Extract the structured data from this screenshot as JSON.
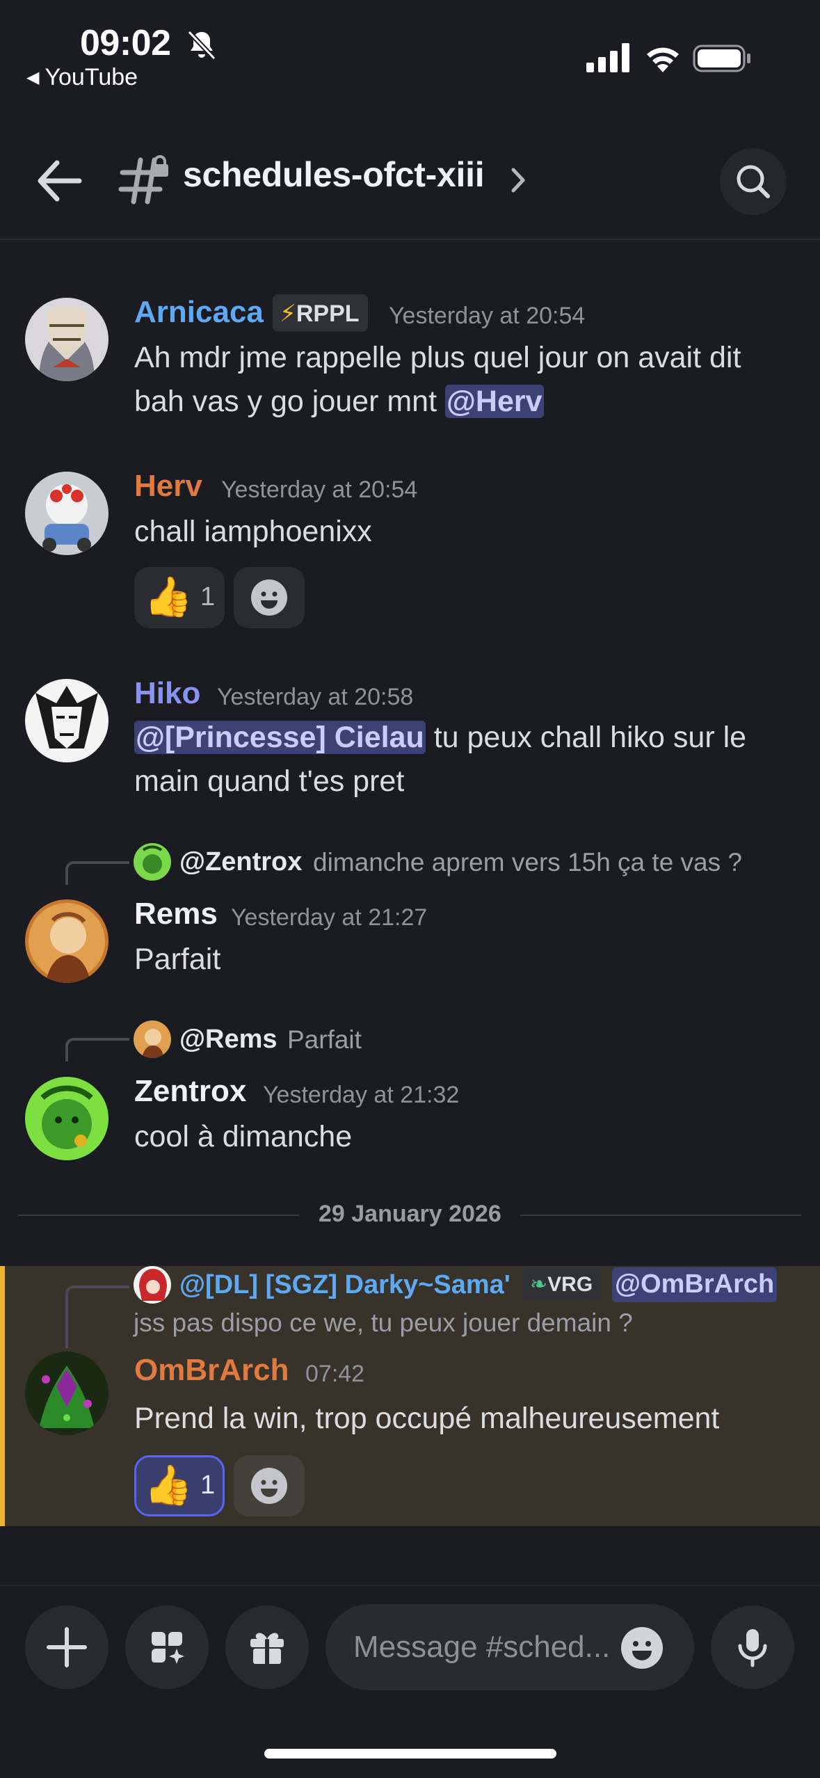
{
  "status_bar": {
    "time": "09:02",
    "back_app": "YouTube"
  },
  "header": {
    "channel_name": "schedules-ofct-xiii"
  },
  "messages": [
    {
      "username": "Arnicaca",
      "username_color": "#5ea9f4",
      "tag": "RPPL",
      "timestamp": "Yesterday at 20:54",
      "text_line1": "Ah mdr jme rappelle plus quel jour on avait dit",
      "text_line2": "bah vas y go jouer mnt",
      "mention": "@Herv"
    },
    {
      "username": "Herv",
      "username_color": "#e07a3f",
      "timestamp": "Yesterday at 20:54",
      "text": "chall iamphoenixx",
      "reaction_emoji": "👍",
      "reaction_count": "1"
    },
    {
      "username": "Hiko",
      "username_color": "#8b93f0",
      "timestamp": "Yesterday at 20:58",
      "mention": "@[Princesse] Cielau",
      "text_line1": " tu peux chall hiko sur le",
      "text_line2": "main quand t'es pret"
    },
    {
      "reply_name": "@Zentrox",
      "reply_text": "dimanche aprem vers 15h ça te vas ?",
      "username": "Rems",
      "username_color": "#f2f3f5",
      "timestamp": "Yesterday at 21:27",
      "text": "Parfait"
    },
    {
      "reply_name": "@Rems",
      "reply_text": "Parfait",
      "username": "Zentrox",
      "username_color": "#f2f3f5",
      "timestamp": "Yesterday at 21:32",
      "text": "cool à dimanche"
    },
    {
      "reply_name": "@[DL] [SGZ] Darky~Sama'",
      "reply_name_color": "#5ea9f4",
      "reply_tag": "VRG",
      "reply_mention": "@OmBrArch",
      "reply_text": "jss pas dispo ce we, tu peux jouer demain ?",
      "username": "OmBrArch",
      "username_color": "#e07a3f",
      "timestamp": "07:42",
      "text": "Prend la win, trop occupé malheureusement",
      "reaction_emoji": "👍",
      "reaction_count": "1"
    }
  ],
  "date_separator": "29 January 2026",
  "composer": {
    "placeholder": "Message #sched..."
  },
  "icons": {
    "plus": "plus-icon",
    "apps": "apps-icon",
    "gift": "gift-icon",
    "emoji": "emoji-icon",
    "mic": "microphone-icon"
  },
  "colors": {
    "background": "#1b1c21",
    "highlight_bar": "#f0b232",
    "mention_bg": "#3c4275"
  }
}
